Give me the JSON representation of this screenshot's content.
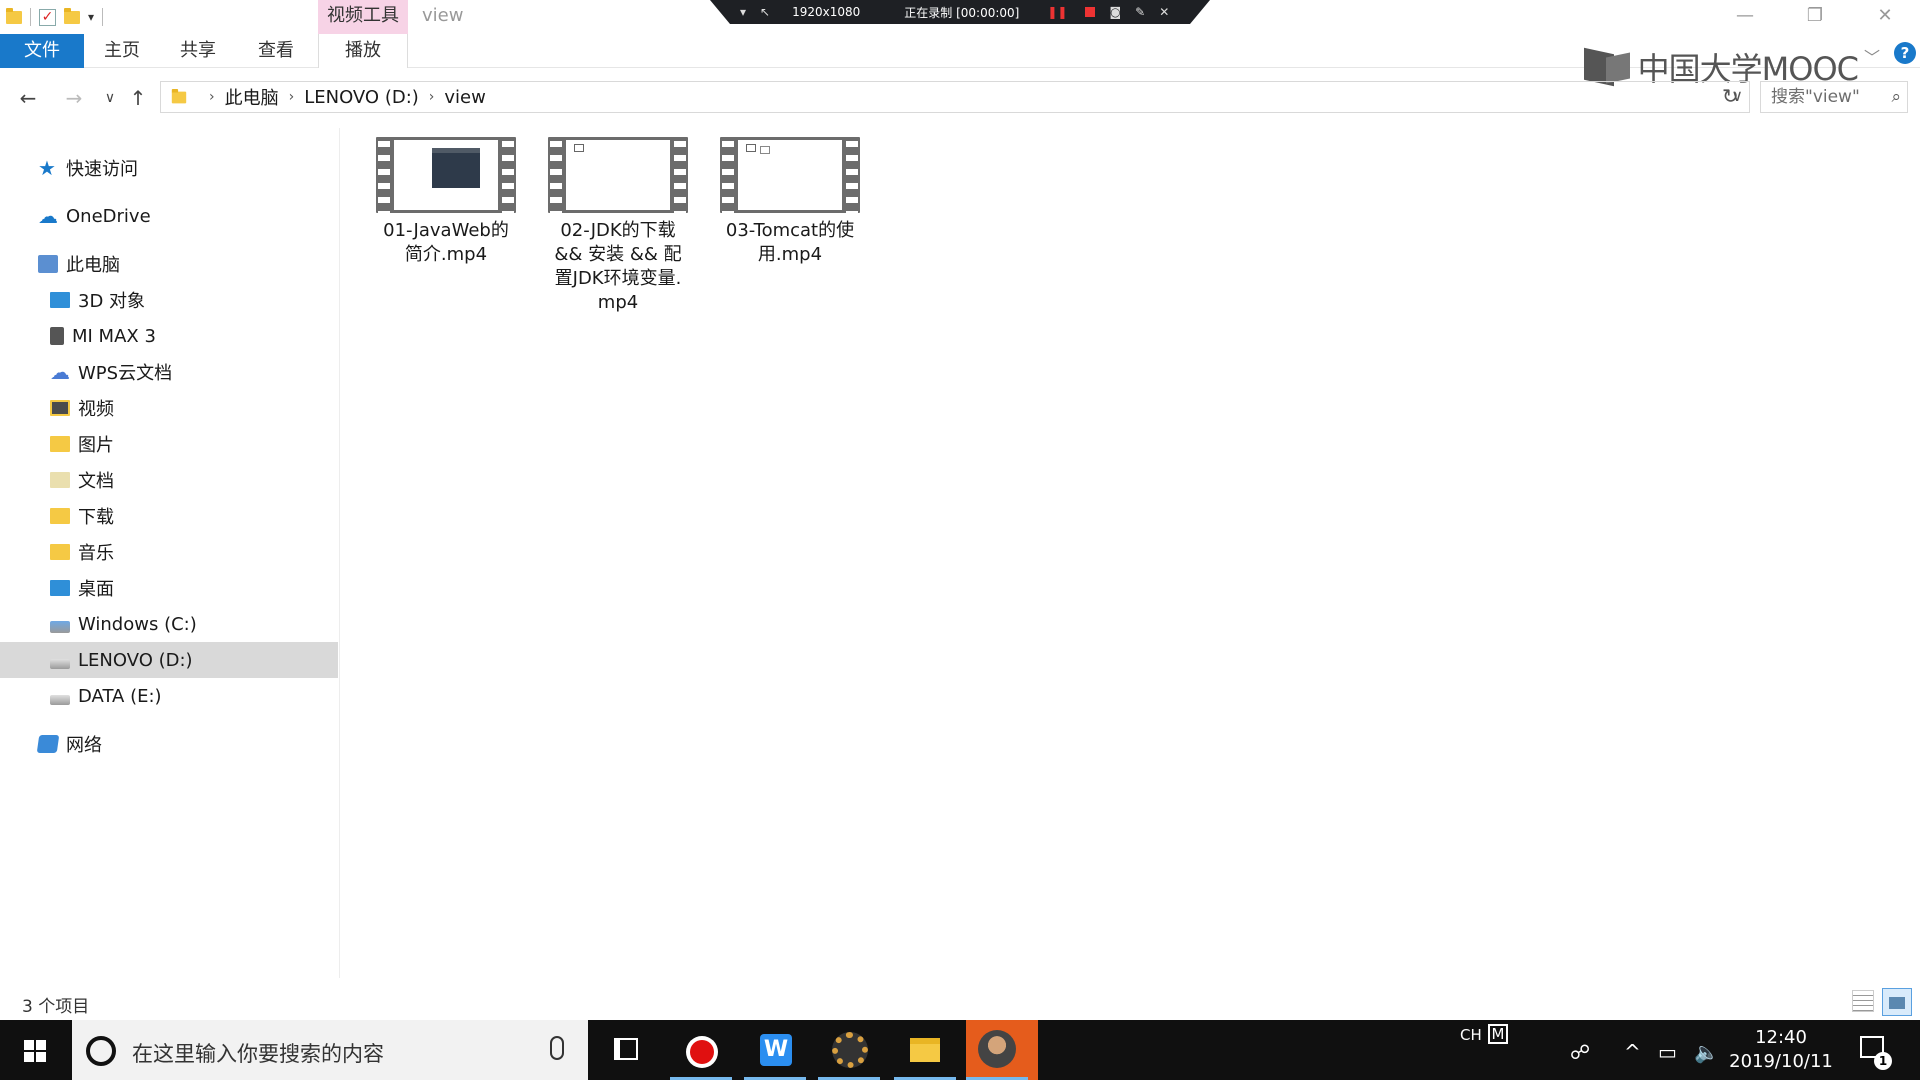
{
  "titlebar": {
    "contextual_tab": "视频工具",
    "window_title": "view",
    "minimize_glyph": "—",
    "restore_glyph": "❐",
    "close_glyph": "✕"
  },
  "recorder": {
    "resolution": "1920x1080",
    "status": "正在录制 [00:00:00]"
  },
  "ribbon": {
    "tabs": [
      "文件",
      "主页",
      "共享",
      "查看",
      "播放"
    ],
    "brand": "中国大学MOOC"
  },
  "address": {
    "breadcrumbs": [
      "此电脑",
      "LENOVO (D:)",
      "view"
    ],
    "search_placeholder": "搜索\"view\""
  },
  "sidebar": {
    "items": [
      {
        "label": "快速访问",
        "icon": "star-icon"
      },
      {
        "label": "OneDrive",
        "icon": "cloud-icon"
      },
      {
        "label": "此电脑",
        "icon": "computer-icon"
      },
      {
        "label": "3D 对象",
        "icon": "3d-objects-folder-icon"
      },
      {
        "label": "MI MAX 3",
        "icon": "phone-icon"
      },
      {
        "label": "WPS云文档",
        "icon": "wps-cloud-icon"
      },
      {
        "label": "视频",
        "icon": "videos-folder-icon"
      },
      {
        "label": "图片",
        "icon": "pictures-folder-icon"
      },
      {
        "label": "文档",
        "icon": "documents-folder-icon"
      },
      {
        "label": "下载",
        "icon": "downloads-folder-icon"
      },
      {
        "label": "音乐",
        "icon": "music-folder-icon"
      },
      {
        "label": "桌面",
        "icon": "desktop-folder-icon"
      },
      {
        "label": "Windows (C:)",
        "icon": "windows-drive-icon"
      },
      {
        "label": "LENOVO (D:)",
        "icon": "drive-icon"
      },
      {
        "label": "DATA (E:)",
        "icon": "drive-icon"
      },
      {
        "label": "网络",
        "icon": "network-icon"
      }
    ],
    "selected": "LENOVO (D:)"
  },
  "files": [
    {
      "name_lines": [
        "01-JavaWeb的",
        "简介.mp4"
      ]
    },
    {
      "name_lines": [
        "02-JDK的下载",
        "&& 安装 && 配",
        "置JDK环境变量.",
        "mp4"
      ]
    },
    {
      "name_lines": [
        "03-Tomcat的使",
        "用.mp4"
      ]
    }
  ],
  "status": {
    "item_count": "3 个项目"
  },
  "taskbar": {
    "search_placeholder": "在这里输入你要搜索的内容",
    "ime": "CH",
    "ime_mode": "M",
    "time": "12:40",
    "date": "2019/10/11",
    "notification_count": "1"
  }
}
